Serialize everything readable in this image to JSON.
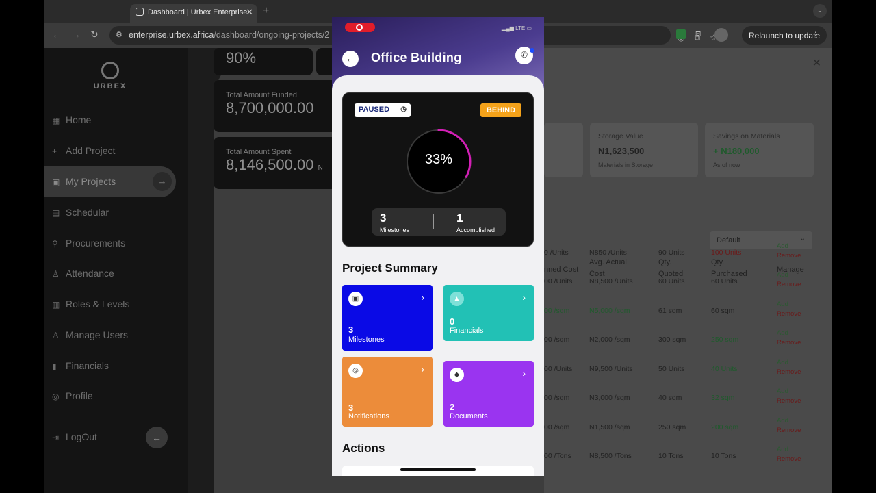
{
  "browser": {
    "tab_title": "Dashboard | Urbex Enterprise",
    "url_host": "enterprise.urbex.africa",
    "url_path": "/dashboard/ongoing-projects/2",
    "relaunch": "Relaunch to update"
  },
  "sidebar": {
    "logo": "URBEX",
    "items": [
      {
        "label": "Home"
      },
      {
        "label": "Add Project"
      },
      {
        "label": "My Projects"
      },
      {
        "label": "Schedular"
      },
      {
        "label": "Procurements"
      },
      {
        "label": "Attendance"
      },
      {
        "label": "Roles & Levels"
      },
      {
        "label": "Manage Users"
      },
      {
        "label": "Financials"
      },
      {
        "label": "Profile"
      }
    ],
    "logout": "LogOut"
  },
  "background_stats": {
    "top_val": "90%",
    "funded_label": "Total Amount Funded",
    "funded_value": "8,700,000.00",
    "spent_label": "Total Amount Spent",
    "spent_value": "8,146,500.00",
    "spent_suffix": "N"
  },
  "right_panel": {
    "storage": {
      "title": "Storage Value",
      "value": "N1,623,500",
      "sub": "Materials in Storage"
    },
    "savings": {
      "title": "Savings on Materials",
      "value": "+ N180,000",
      "sub": "As of now"
    },
    "sort_default": "Default",
    "headers": [
      "nned Cost",
      "Avg. Actual Cost",
      "Qty. Quoted",
      "Qty. Purchased",
      "Manage"
    ],
    "rows": [
      {
        "planned": "0 /Units",
        "actual": "N850 /Units",
        "quoted": "90 Units",
        "purchased": "100 Units"
      },
      {
        "planned": "00 /Units",
        "actual": "N8,500 /Units",
        "quoted": "60 Units",
        "purchased": "60 Units"
      },
      {
        "planned": "00 /sqm",
        "actual": "N5,000 /sqm",
        "quoted": "61 sqm",
        "purchased": "60 sqm"
      },
      {
        "planned": "00 /sqm",
        "actual": "N2,000 /sqm",
        "quoted": "300 sqm",
        "purchased": "250 sqm"
      },
      {
        "planned": "00 /Units",
        "actual": "N9,500 /Units",
        "quoted": "50 Units",
        "purchased": "40 Units"
      },
      {
        "planned": "00 /sqm",
        "actual": "N3,000 /sqm",
        "quoted": "40 sqm",
        "purchased": "32 sqm"
      },
      {
        "planned": "00 /sqm",
        "actual": "N1,500 /sqm",
        "quoted": "250 sqm",
        "purchased": "200 sqm"
      },
      {
        "planned": "00 /Tons",
        "actual": "N8,500 /Tons",
        "quoted": "10 Tons",
        "purchased": "10 Tons"
      }
    ],
    "add": "Add",
    "remove": "Remove"
  },
  "phone": {
    "network": "LTE",
    "title": "Office Building",
    "status_badge": "PAUSED",
    "schedule_badge": "BEHIND",
    "progress_text": "33%",
    "progress_value": 0.33,
    "milestones_count": "3",
    "milestones_label": "Milestones",
    "accomplished_count": "1",
    "accomplished_label": "Accomplished",
    "summary_title": "Project Summary",
    "tiles": [
      {
        "count": "3",
        "label": "Milestones",
        "color": "#0a0ae6"
      },
      {
        "count": "0",
        "label": "Financials",
        "color": "#22c1b5"
      },
      {
        "count": "3",
        "label": "Notifications",
        "color": "#ec8c3a"
      },
      {
        "count": "2",
        "label": "Documents",
        "color": "#9a34f0"
      }
    ],
    "actions_title": "Actions"
  }
}
